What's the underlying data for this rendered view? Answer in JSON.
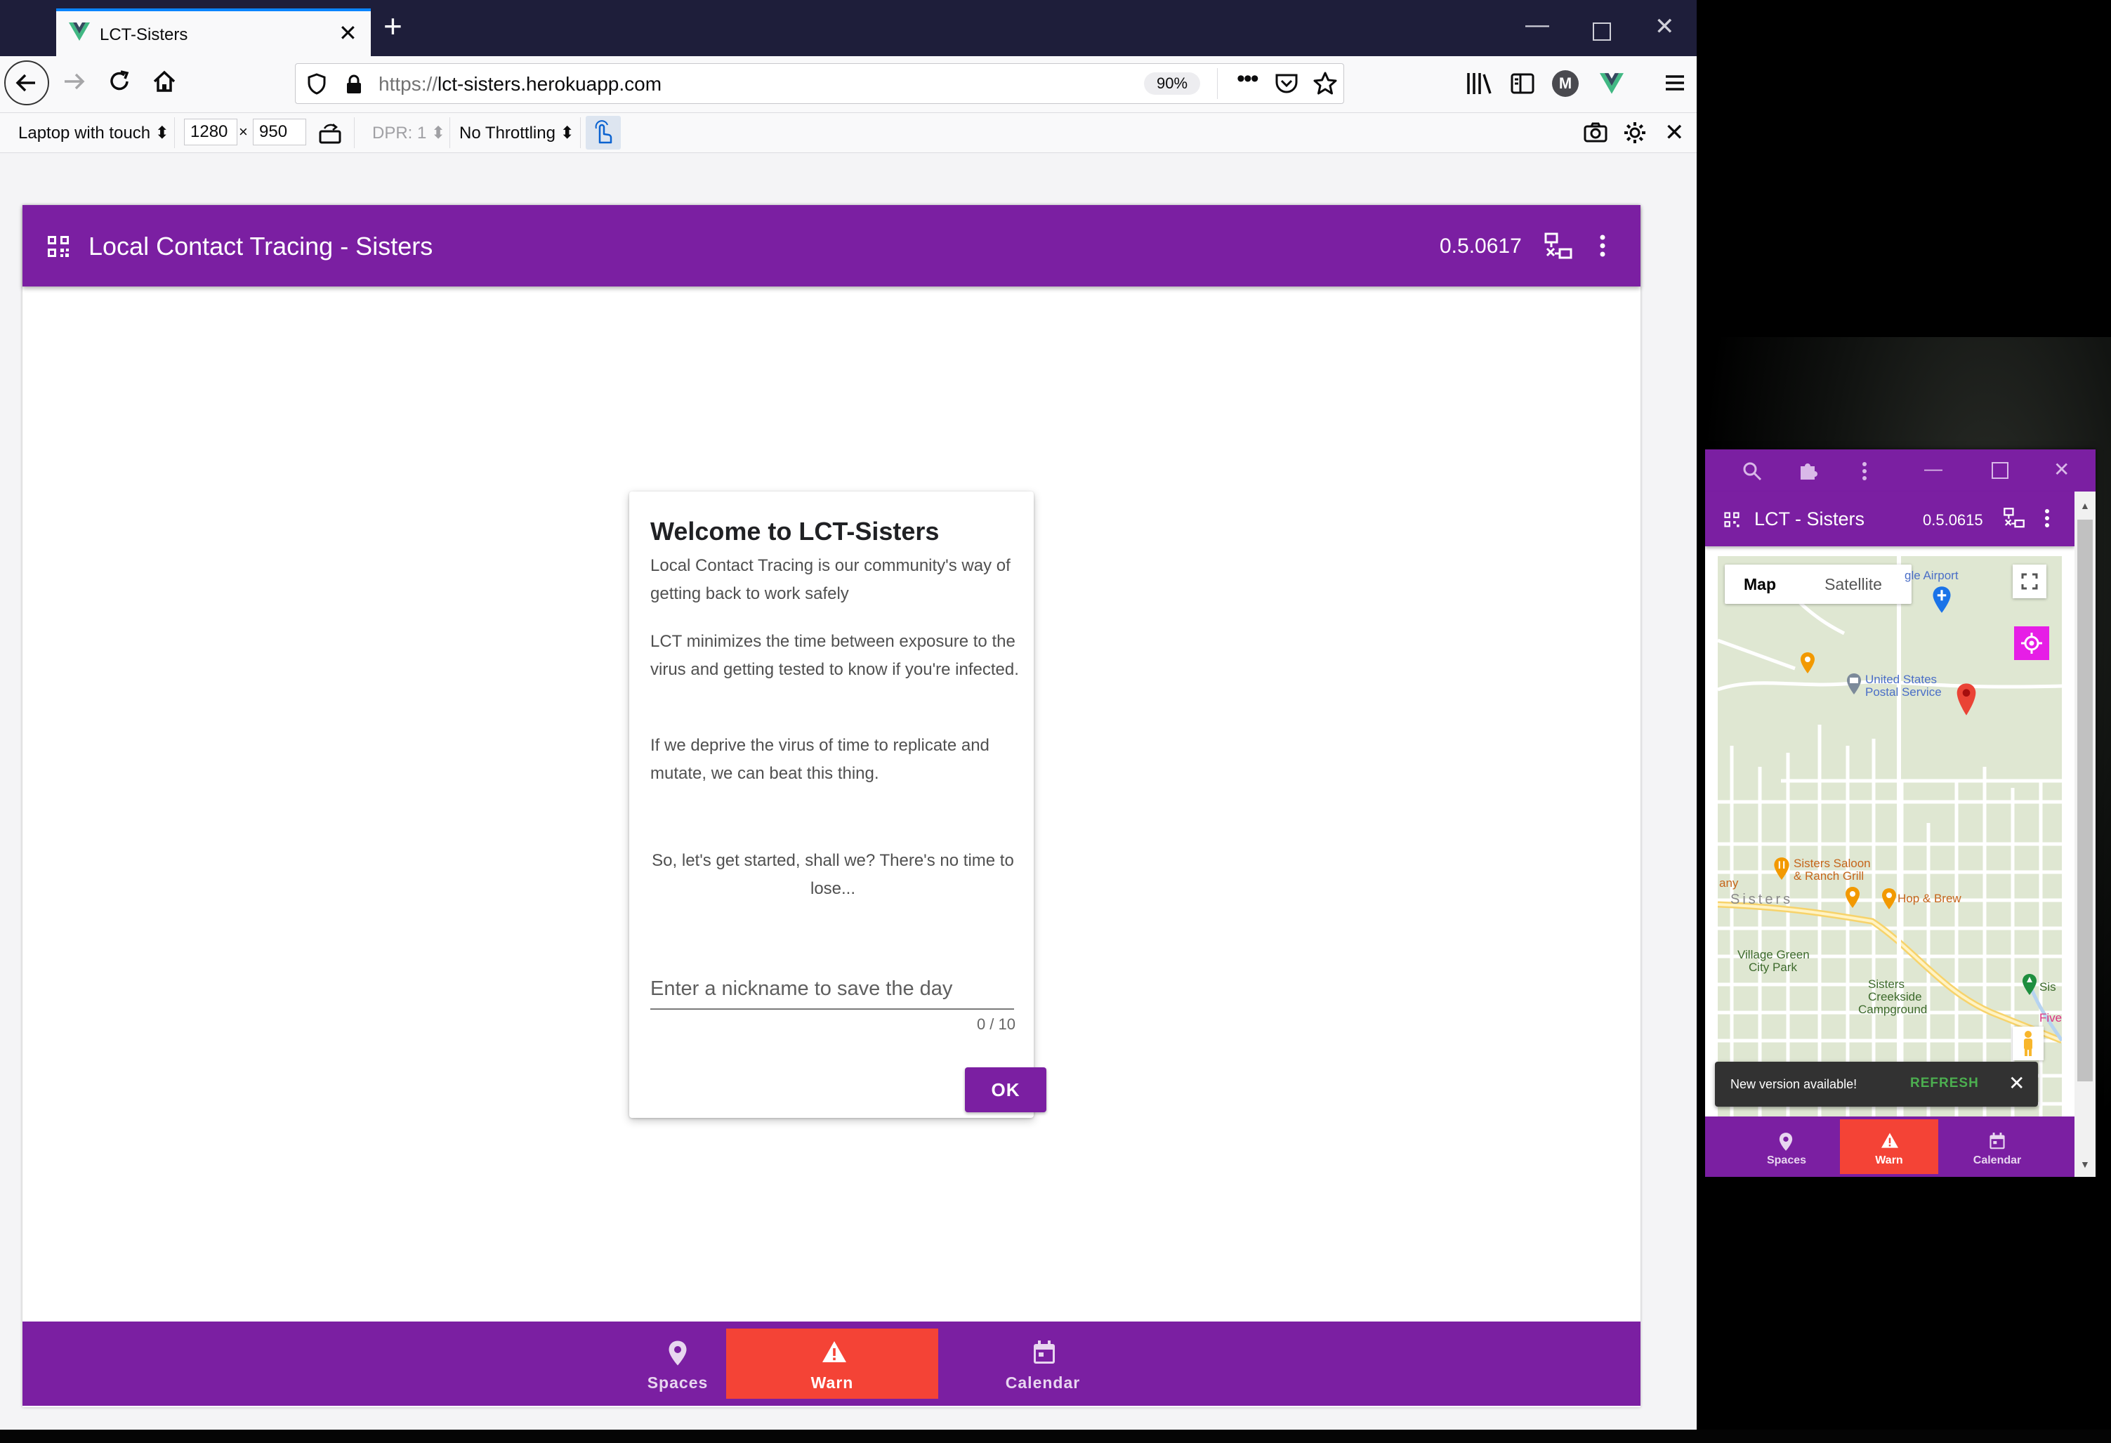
{
  "browser": {
    "tab_title": "LCT-Sisters",
    "url_scheme": "https://",
    "url_host": "lct-sisters.herokuapp.com",
    "zoom": "90%",
    "rdm": {
      "device": "Laptop with touch",
      "width": "1280",
      "times": "×",
      "height": "950",
      "dpr": "DPR: 1",
      "throttling": "No Throttling"
    }
  },
  "app": {
    "title": "Local Contact Tracing - Sisters",
    "version": "0.5.0617",
    "dialog": {
      "title": "Welcome to LCT-Sisters",
      "p1": "Local Contact Tracing is our community's way of getting back to work safely",
      "p2": "LCT minimizes the time between exposure to the virus and getting tested to know if you're infected.",
      "p3": "If we deprive the virus of time to replicate and mutate, we can beat this thing.",
      "p4": "So, let's get started, shall we? There's no time to lose...",
      "input_placeholder": "Enter a nickname to save the day",
      "counter": "0 / 10",
      "ok_label": "OK"
    },
    "nav": {
      "spaces": "Spaces",
      "warn": "Warn",
      "calendar": "Calendar"
    },
    "colors": {
      "primary": "#7b1fa2",
      "warn": "#f44336"
    }
  },
  "pwa": {
    "title": "LCT - Sisters",
    "version": "0.5.0615",
    "map": {
      "map_label": "Map",
      "satellite_label": "Satellite",
      "labels": {
        "airport": "gle Airport",
        "post1": "United States",
        "post2": "Postal Service",
        "saloon1": "Sisters Saloon",
        "saloon2": "& Ranch Grill",
        "hop": "Hop & Brew",
        "sisters": "Sisters",
        "park1": "Village Green",
        "park2": "City Park",
        "camp1": "Sisters",
        "camp2": "Creekside",
        "camp3": "Campground",
        "any": "any",
        "five": "Five",
        "sis": "Sis"
      }
    },
    "toast": {
      "message": "New version available!",
      "action": "REFRESH"
    },
    "nav": {
      "spaces": "Spaces",
      "warn": "Warn",
      "calendar": "Calendar"
    }
  }
}
